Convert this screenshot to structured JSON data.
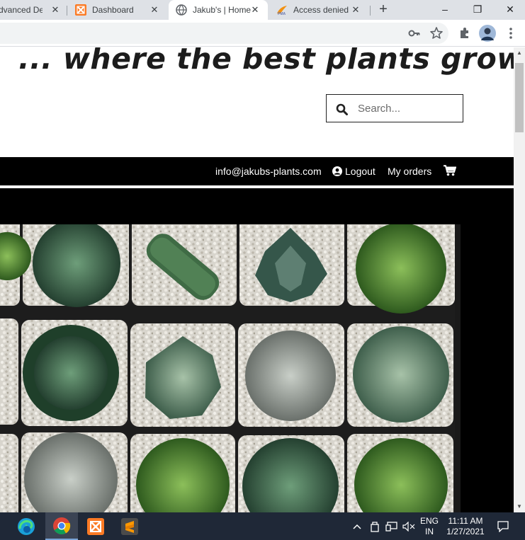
{
  "browser": {
    "tabs": [
      {
        "title": "Advanced Dev",
        "active": false
      },
      {
        "title": "Dashboard",
        "active": false
      },
      {
        "title": "Jakub's | Home",
        "active": true
      },
      {
        "title": "Access denied",
        "active": false
      }
    ],
    "new_tab_label": "+",
    "window_controls": {
      "minimize": "–",
      "restore": "❐",
      "close": "✕"
    },
    "toolbar_icons": [
      "key-icon",
      "star-icon",
      "extensions-icon",
      "profile-icon",
      "menu-icon"
    ]
  },
  "page": {
    "slogan": "... where the best plants grow",
    "search": {
      "placeholder": "Search..."
    },
    "nav": {
      "email": "info@jakubs-plants.com",
      "logout": "Logout",
      "orders": "My orders",
      "cart_icon": "cart-icon"
    },
    "hero_alt": "succulents-grid-image"
  },
  "taskbar": {
    "apps": [
      "edge-icon",
      "chrome-icon",
      "xampp-icon",
      "sublime-icon"
    ],
    "language_top": "ENG",
    "language_bottom": "IN",
    "time": "11:11 AM",
    "date": "1/27/2021"
  },
  "colors": {
    "tabstrip": "#dee1e6",
    "navbar": "#000000",
    "taskbar": "#1f2837",
    "xampp": "#fb7a24",
    "sublime": "#ff9800"
  }
}
